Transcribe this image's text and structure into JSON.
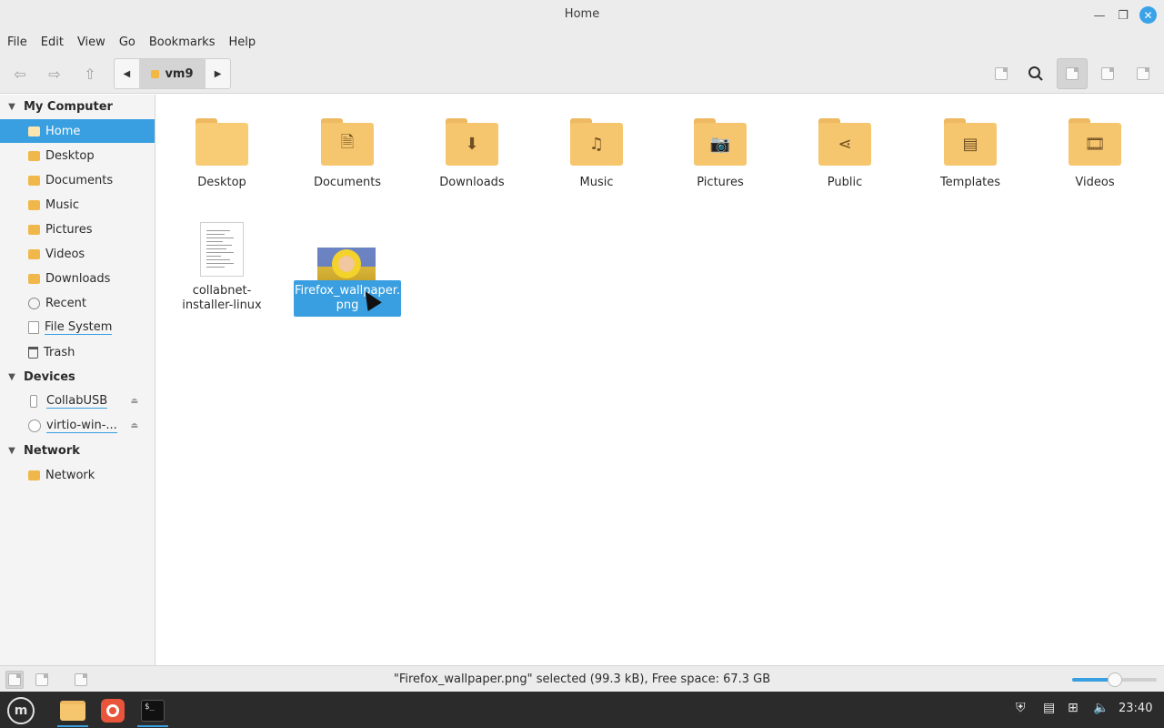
{
  "window": {
    "title": "Home"
  },
  "menu": [
    "File",
    "Edit",
    "View",
    "Go",
    "Bookmarks",
    "Help"
  ],
  "breadcrumb": {
    "current": "vm9"
  },
  "sidebar": {
    "sections": [
      {
        "title": "My Computer"
      },
      {
        "title": "Devices"
      },
      {
        "title": "Network"
      }
    ],
    "places": [
      {
        "label": "Home",
        "icon": "home-folder-icon",
        "selected": true
      },
      {
        "label": "Desktop",
        "icon": "desktop-folder-icon"
      },
      {
        "label": "Documents",
        "icon": "documents-folder-icon"
      },
      {
        "label": "Music",
        "icon": "music-folder-icon"
      },
      {
        "label": "Pictures",
        "icon": "pictures-folder-icon"
      },
      {
        "label": "Videos",
        "icon": "videos-folder-icon"
      },
      {
        "label": "Downloads",
        "icon": "downloads-folder-icon"
      },
      {
        "label": "Recent",
        "icon": "recent-icon"
      },
      {
        "label": "File System",
        "icon": "drive-icon"
      },
      {
        "label": "Trash",
        "icon": "trash-icon"
      }
    ],
    "devices": [
      {
        "label": "CollabUSB",
        "icon": "usb-drive-icon"
      },
      {
        "label": "virtio-win-...",
        "icon": "optical-disc-icon"
      }
    ],
    "network": [
      {
        "label": "Network",
        "icon": "network-folder-icon"
      }
    ]
  },
  "folders": [
    {
      "label": "Desktop",
      "glyph": ""
    },
    {
      "label": "Documents",
      "glyph": "🗎"
    },
    {
      "label": "Downloads",
      "glyph": "⬇"
    },
    {
      "label": "Music",
      "glyph": "♫"
    },
    {
      "label": "Pictures",
      "glyph": "📷"
    },
    {
      "label": "Public",
      "glyph": "⋖"
    },
    {
      "label": "Templates",
      "glyph": "▤"
    },
    {
      "label": "Videos",
      "glyph": "🎞"
    }
  ],
  "files": [
    {
      "label_line1": "collabnet-",
      "label_line2": "installer-linux"
    },
    {
      "label_line1": "Firefox_wallpaper.",
      "label_line2": "png"
    }
  ],
  "status": {
    "text": "\"Firefox_wallpaper.png\" selected (99.3 kB), Free space: 67.3 GB",
    "zoom_level": 0.5
  },
  "taskbar": {
    "clock": "23:40"
  },
  "colors": {
    "accent": "#3a9fe0",
    "folder": "#f6c66e",
    "taskbar": "#2b2b2b"
  }
}
